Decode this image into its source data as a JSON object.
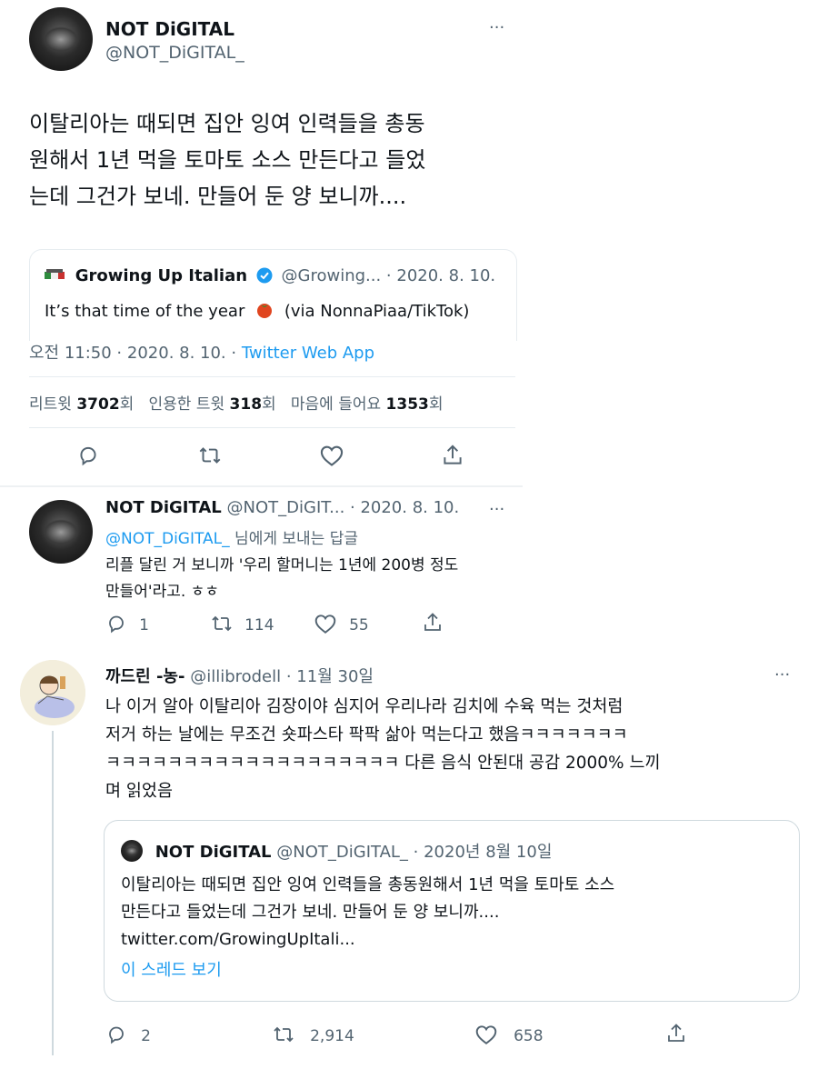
{
  "tweet1": {
    "display_name": "NOT DiGITAL",
    "handle": "@NOT_DiGITAL_",
    "more": "···",
    "text_lines": [
      "이탈리아는 때되면 집안 잉여 인력들을 총동",
      "원해서 1년 먹을 토마토 소스 만든다고 들었",
      "는데 그건가 보네. 만들어 둔 양 보니까...."
    ],
    "quote": {
      "name": "Growing Up Italian",
      "handle_date": "@Growing... · 2020. 8. 10.",
      "text_before": "It’s that time of the year",
      "text_after": "(via NonnaPiaa/TikTok)"
    },
    "timestamp": "오전 11:50 · 2020. 8. 10. · ",
    "source": "Twitter Web App",
    "stats": {
      "retweets_label": "리트윗",
      "retweets": "3702",
      "retweets_unit": "회",
      "quotes_label": "인용한 트윗",
      "quotes": "318",
      "quotes_unit": "회",
      "likes_label": "마음에 들어요",
      "likes": "1353",
      "likes_unit": "회"
    }
  },
  "tweet2": {
    "display_name": "NOT DiGITAL",
    "handle_date": "@NOT_DiGIT... · 2020. 8. 10.",
    "more": "···",
    "reply_to_handle": "@NOT_DiGITAL_",
    "reply_to_suffix": " 님에게 보내는 답글",
    "text_lines": [
      "리플 달린 거 보니까 '우리 할머니는 1년에 200병 정도",
      "만들어'라고. ㅎㅎ"
    ],
    "replies": "1",
    "retweets": "114",
    "likes": "55"
  },
  "tweet3": {
    "display_name": "까드린 -농-",
    "handle_date": "@illibrodell · 11월 30일",
    "more": "···",
    "text_lines": [
      "나 이거 알아 이탈리아 김장이야 심지어 우리나라 김치에 수육 먹는 것처럼",
      "저거 하는 날에는 무조건 숏파스타 팍팍 삶아 먹는다고 했음ㅋㅋㅋㅋㅋㅋㅋ",
      "ㅋㅋㅋㅋㅋㅋㅋㅋㅋㅋㅋㅋㅋㅋㅋㅋㅋㅋㅋ 다른 음식 안된대 공감 2000% 느끼",
      "며 읽었음"
    ],
    "quote": {
      "name": "NOT DiGITAL",
      "handle_date": "@NOT_DiGITAL_ · 2020년 8월 10일",
      "text_lines": [
        "이탈리아는 때되면 집안 잉여 인력들을 총동원해서 1년 먹을 토마토 소스",
        "만든다고 들었는데 그건가 보네. 만들어 둔 양 보니까...."
      ],
      "url": "twitter.com/GrowingUpItali...",
      "show_thread": "이 스레드 보기"
    },
    "replies": "2",
    "retweets": "2,914",
    "likes": "658"
  },
  "colors": {
    "accent": "#1d9bf0",
    "muted": "#536471",
    "verified": "#1d9bf0"
  },
  "icons": [
    "reply-icon",
    "retweet-icon",
    "like-icon",
    "share-icon",
    "verified-badge-icon",
    "tomato-emoji-icon",
    "more-icon"
  ]
}
